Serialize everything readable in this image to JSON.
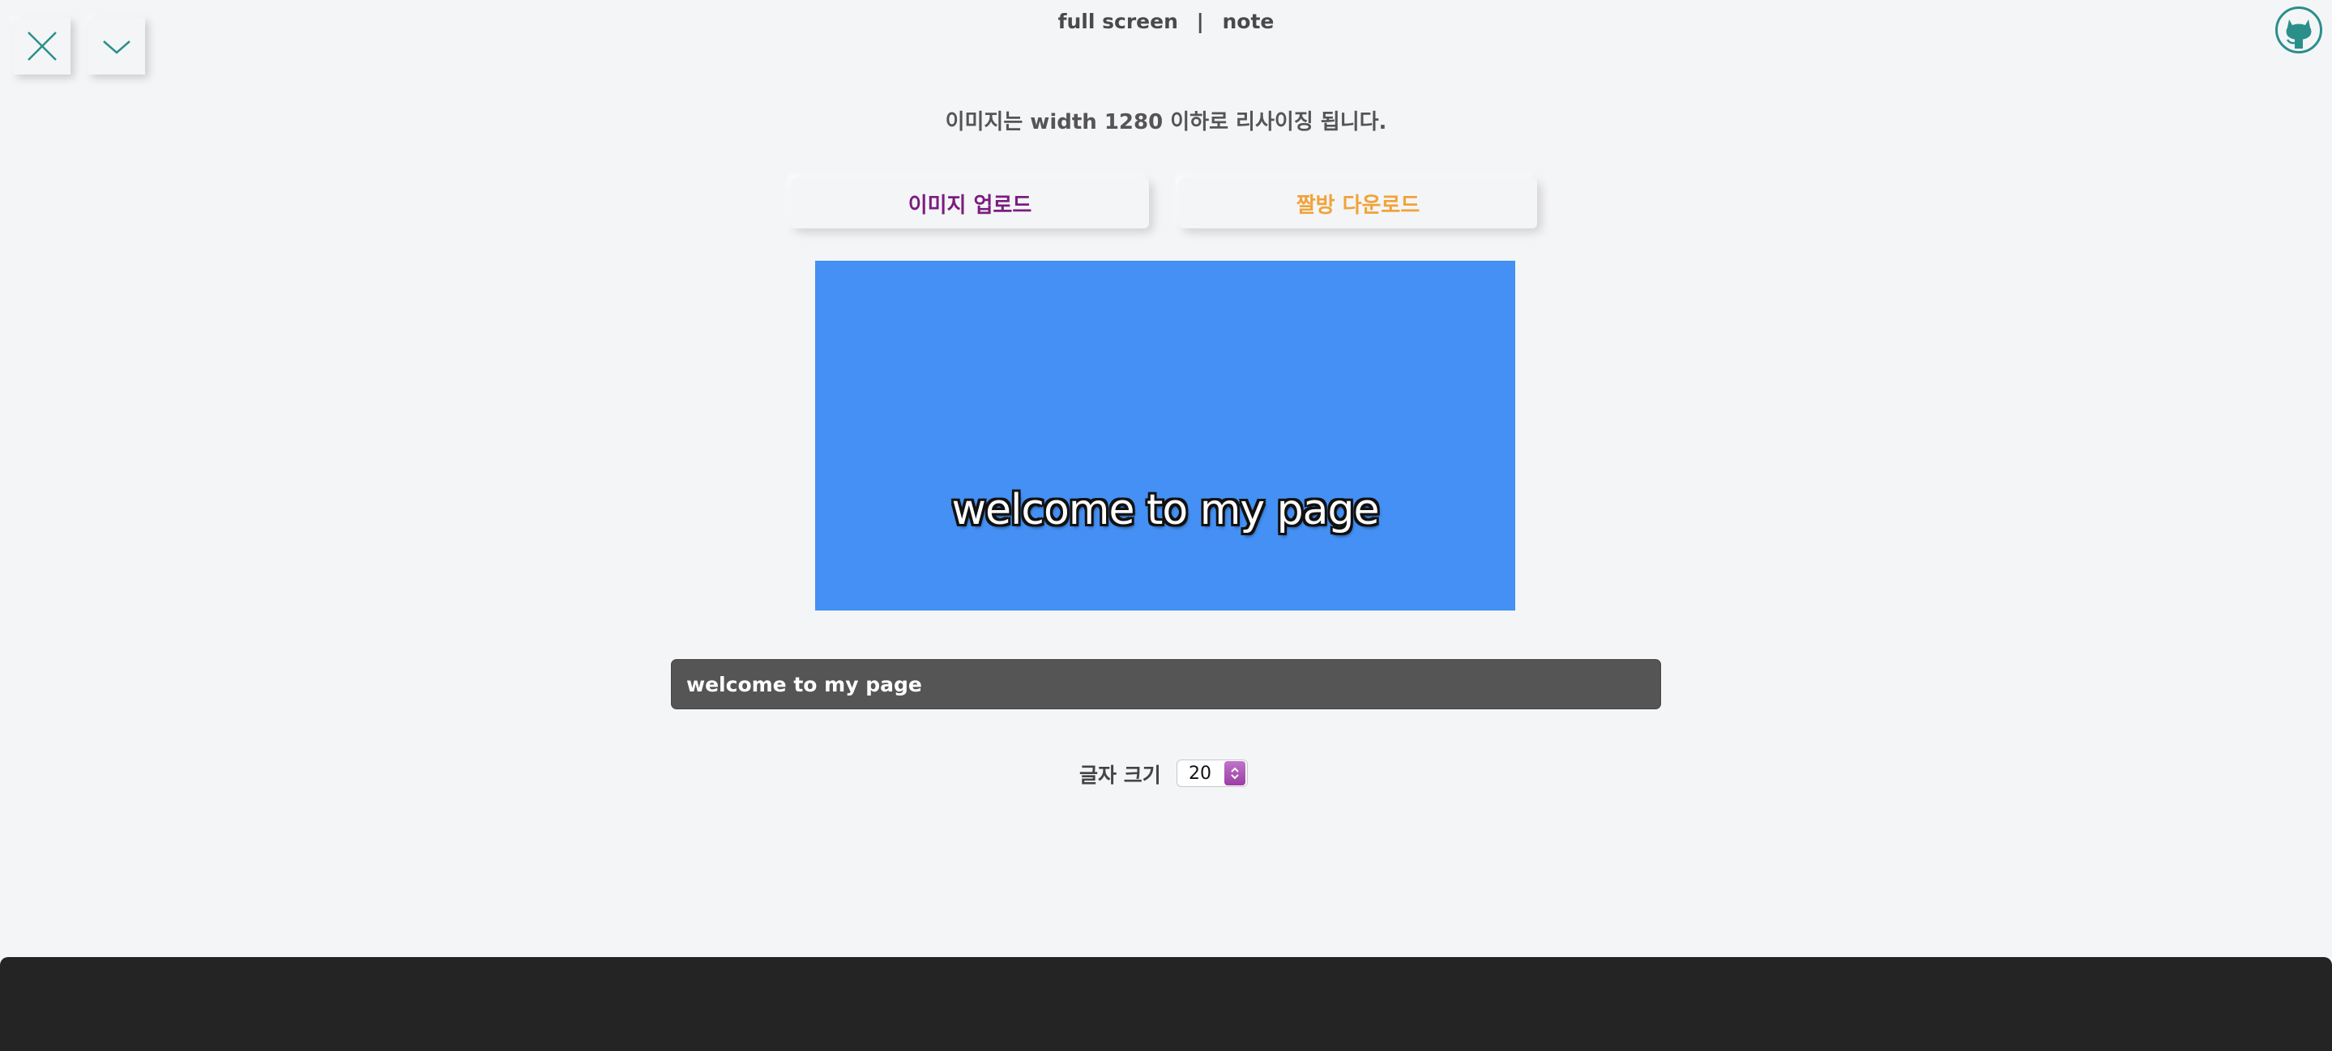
{
  "controls": {
    "close_icon": "close-icon",
    "collapse_icon": "chevron-down-icon"
  },
  "nav": {
    "fullscreen": "full screen",
    "separator": "|",
    "note": "note",
    "github_icon": "github-octocat-icon"
  },
  "notice": "이미지는 width 1280 이하로 리사이징 됩니다.",
  "actions": {
    "upload_label": "이미지 업로드",
    "download_label": "짤방 다운로드"
  },
  "preview": {
    "caption": "welcome to my page",
    "background_color": "#4490f4"
  },
  "caption_input": {
    "value": "welcome to my page"
  },
  "font_size": {
    "label": "글자 크기",
    "value": "20"
  },
  "colors": {
    "accent": "#2a8f8b",
    "upload_text": "#7a1d7f",
    "download_text": "#f0a33a",
    "footer": "#242424"
  }
}
